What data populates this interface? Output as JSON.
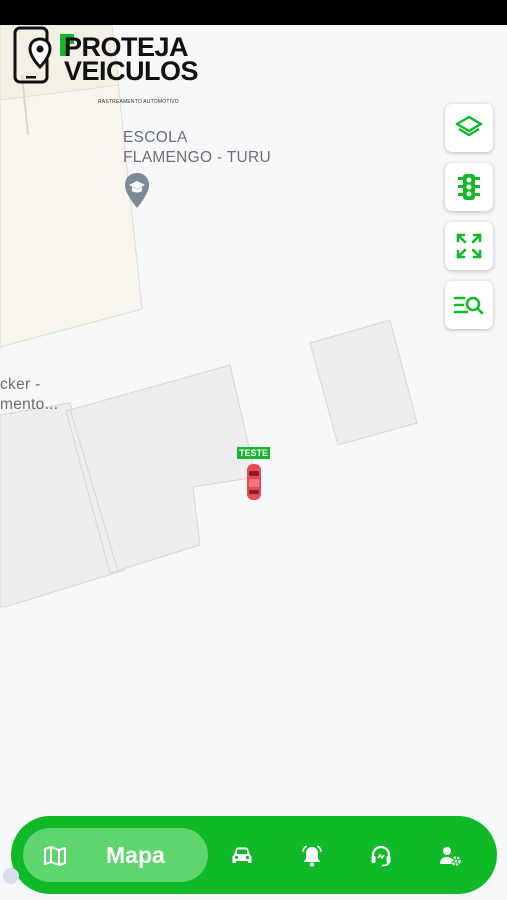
{
  "map": {
    "poi": {
      "name_line1": "ESCOLA",
      "name_line2": "FLAMENGO - TURU",
      "icon": "school-marker-icon"
    },
    "partial_poi": {
      "line1": "cker -",
      "line2": "mento..."
    },
    "vehicle": {
      "label": "TESTE",
      "color": "#e94b55",
      "icon": "car-icon"
    }
  },
  "logo": {
    "line1": "PROTEJA",
    "line2": "VEICULOS",
    "tagline": "RASTREAMENTO AUTOMOTIVO"
  },
  "map_controls": [
    {
      "name": "layers-button",
      "icon": "layers-icon"
    },
    {
      "name": "traffic-button",
      "icon": "traffic-light-icon"
    },
    {
      "name": "fullscreen-button",
      "icon": "expand-icon"
    },
    {
      "name": "search-list-button",
      "icon": "search-list-icon"
    }
  ],
  "bottom_nav": {
    "active_label": "Mapa",
    "items": [
      {
        "name": "nav-map",
        "icon": "map-icon",
        "active": true
      },
      {
        "name": "nav-vehicles",
        "icon": "car-icon",
        "active": false
      },
      {
        "name": "nav-alerts",
        "icon": "bell-icon",
        "active": false
      },
      {
        "name": "nav-support",
        "icon": "headset-icon",
        "active": false
      },
      {
        "name": "nav-account",
        "icon": "user-settings-icon",
        "active": false
      }
    ]
  },
  "colors": {
    "accent": "#0fb928",
    "accent_light": "#5fd56e",
    "map_bg": "#f7f8fa",
    "building": "#ededed",
    "land": "#f9f7f0"
  }
}
